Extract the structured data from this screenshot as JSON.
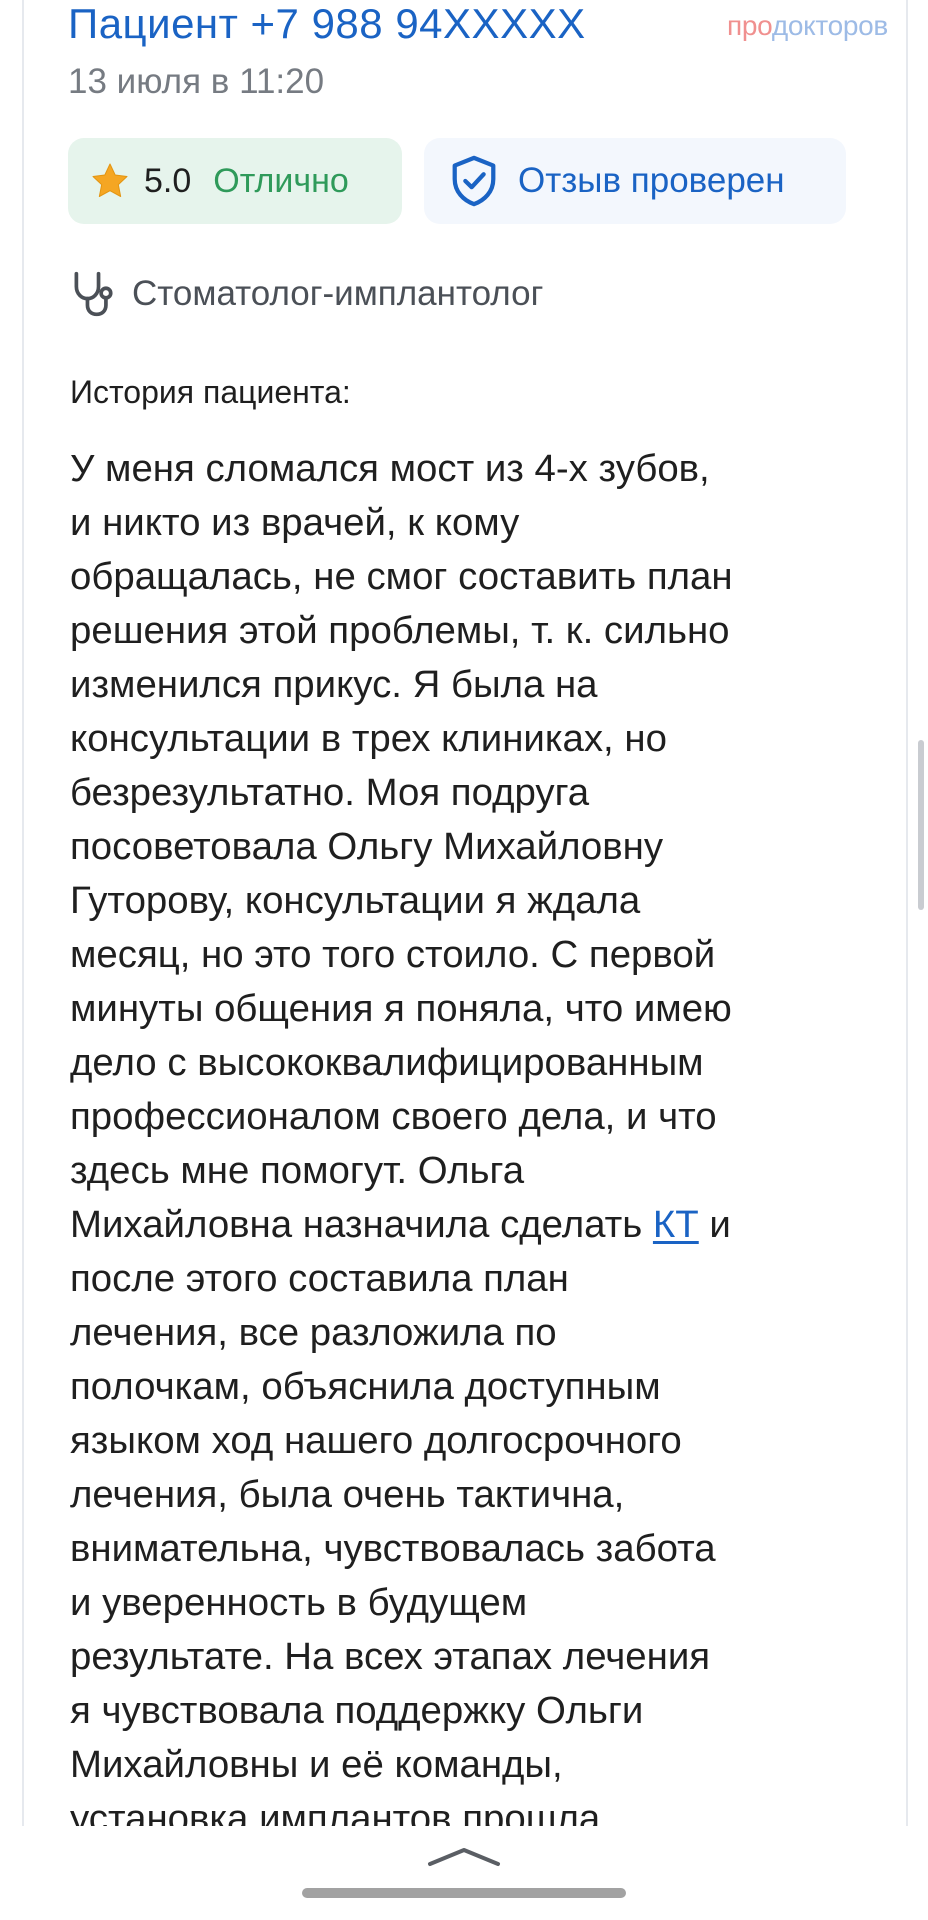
{
  "header": {
    "patient_name": "Пациент +7 988 94XXXXX",
    "brand_pro": "про",
    "brand_doc": "докторов",
    "date": "13 июля в 11:20"
  },
  "badges": {
    "star_icon": "star-icon",
    "rating_value": "5.0",
    "rating_word": "Отлично",
    "shield_icon": "shield-check-icon",
    "verified_text": "Отзыв проверен"
  },
  "specialty": {
    "icon": "stethoscope-icon",
    "label": "Стоматолог-имплантолог"
  },
  "history": {
    "title": "История пациента:",
    "lines": [
      "У меня сломался мост из 4-х зубов,",
      "и никто из врачей, к кому",
      "обращалась, не смог составить план",
      "решения этой проблемы, т. к. сильно",
      "изменился прикус. Я была на",
      "консультации в трех клиниках, но",
      "безрезультатно. Моя подруга",
      "посоветовала Ольгу Михайловну",
      "Гуторову, консультации я ждала",
      "месяц, но это того стоило. С первой",
      "минуты общения я поняла, что имею",
      "дело с высококвалифицированным",
      "профессионалом своего дела, и что",
      "здесь мне помогут. Ольга"
    ],
    "link_line_before": "Михайловна назначила сделать ",
    "link_text": "КТ",
    "link_line_after": " и",
    "lines_after": [
      "после этого составила план",
      "лечения, все разложила по",
      "полочкам, объяснила доступным",
      "языком ход нашего долгосрочного",
      "лечения, была очень тактична,",
      "внимательна, чувствовалась забота",
      "и уверенность в будущем",
      "результате. На всех этапах лечения",
      "я чувствовала поддержку Ольги",
      "Михайловны и её команды,",
      "установка имплантов прошла"
    ]
  },
  "footer": {
    "collapse_icon": "chevron-up-icon"
  },
  "colors": {
    "link_blue": "#1a63c4",
    "rating_green": "#2f9a5a",
    "star_orange": "#f5a623"
  }
}
